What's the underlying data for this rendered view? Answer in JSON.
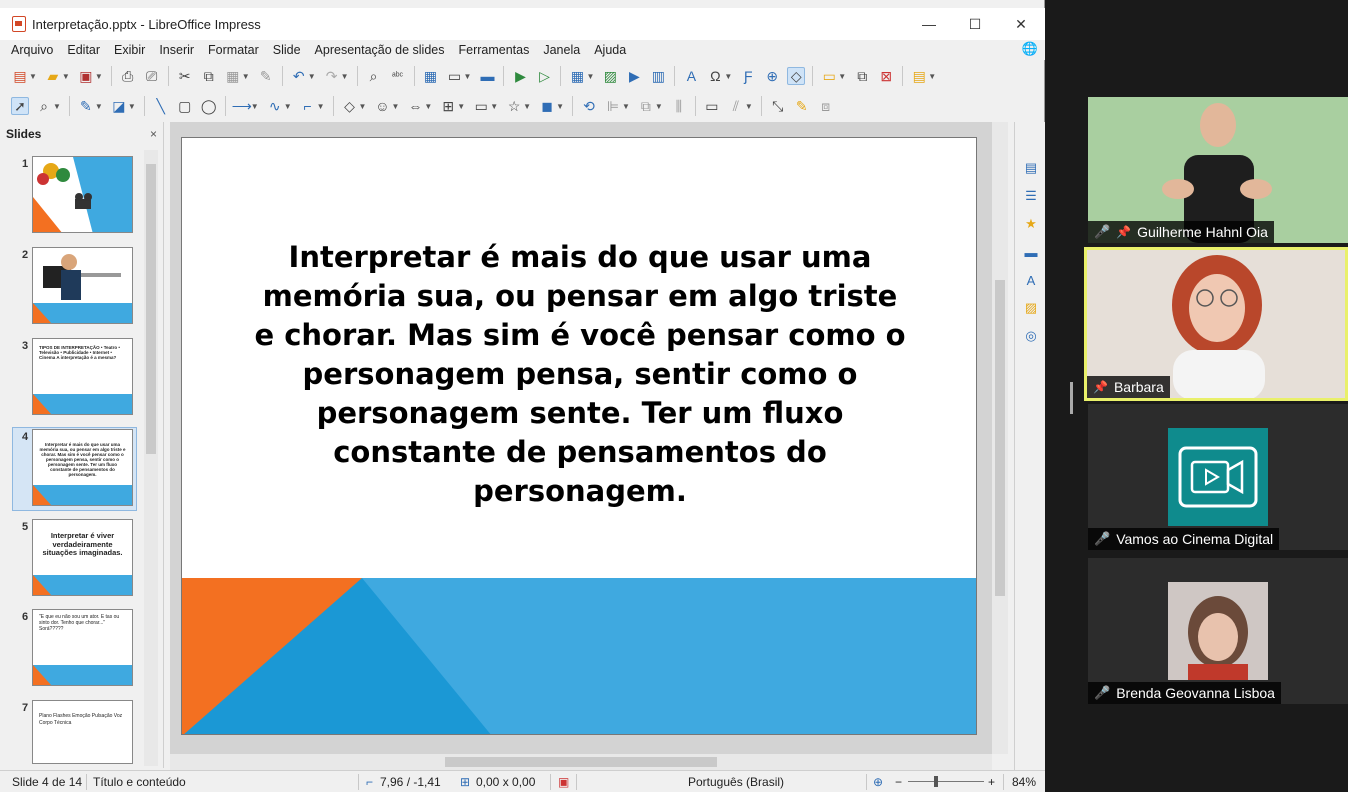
{
  "window": {
    "title": "Interpretação.pptx - LibreOffice Impress",
    "controls": [
      "—",
      "☐",
      "✕"
    ]
  },
  "menu": [
    "Arquivo",
    "Editar",
    "Exibir",
    "Inserir",
    "Formatar",
    "Slide",
    "Apresentação de slides",
    "Ferramentas",
    "Janela",
    "Ajuda"
  ],
  "slides_panel": {
    "title": "Slides",
    "close": "×",
    "thumbs": [
      {
        "num": "1",
        "text": ""
      },
      {
        "num": "2",
        "text": ""
      },
      {
        "num": "3",
        "text": "TIPOS DE INTERPRETAÇÃO • Teatro • Televisão • Publicidade • Internet • Cinema   A interpretação é a mesma?"
      },
      {
        "num": "4",
        "text": "Interpretar é mais do que usar uma memória sua, ou pensar em algo triste e chorar. Mas sim é você pensar como o personagem pensa, sentir como o personagem sente. Ter um fluxo constante de pensamentos do personagem."
      },
      {
        "num": "5",
        "text": "Interpretar é viver verdadeiramente situações imaginadas."
      },
      {
        "num": "6",
        "text": "\"E que eu não sou um ator. E tas ou sinto dor. Tenho que chorar...\"   Sorá?????"
      },
      {
        "num": "7",
        "text": "Plano   Flashes   Emoção   Pulsação   Voz   Corpo   Técnica"
      }
    ]
  },
  "slide": {
    "text": "Interpretar é mais do que usar uma memória sua, ou pensar em algo triste e chorar. Mas sim é você pensar como o personagem pensa, sentir como o personagem sente. Ter um fluxo constante de pensamentos do personagem."
  },
  "status": {
    "slide": "Slide 4 de 14",
    "layout": "Título e conteúdo",
    "position": "7,96 / -1,41",
    "size": "0,00 x 0,00",
    "language": "Português (Brasil)",
    "zoom": "84%"
  },
  "participants": [
    {
      "name": "Guilherme Hahnl Oia",
      "muted": true,
      "pinned": true
    },
    {
      "name": "Barbara",
      "muted": false,
      "pinned": true
    },
    {
      "name": "Vamos ao Cinema Digital",
      "muted": true,
      "pinned": false
    },
    {
      "name": "Brenda Geovanna Lisboa",
      "muted": true,
      "pinned": false
    }
  ],
  "colors": {
    "accent_blue": "#3fa9e0",
    "accent_orange": "#f37021",
    "active_speaker": "#e9f06a"
  }
}
